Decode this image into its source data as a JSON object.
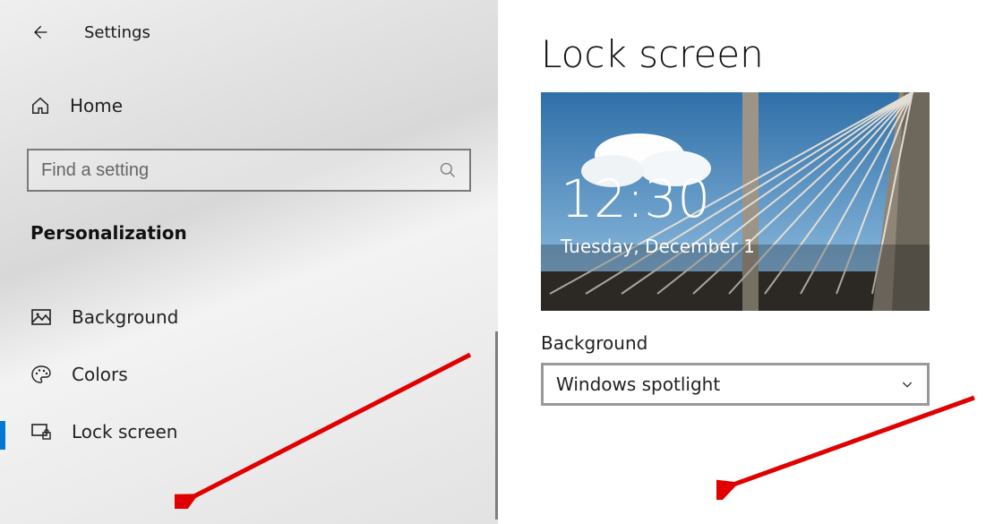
{
  "header": {
    "app_title": "Settings"
  },
  "sidebar": {
    "home_label": "Home",
    "search_placeholder": "Find a setting",
    "section_label": "Personalization",
    "items": [
      {
        "label": "Background"
      },
      {
        "label": "Colors"
      },
      {
        "label": "Lock screen"
      }
    ]
  },
  "main": {
    "page_title": "Lock screen",
    "preview_time": "12:30",
    "preview_date": "Tuesday, December 1",
    "background_label": "Background",
    "background_value": "Windows spotlight"
  }
}
